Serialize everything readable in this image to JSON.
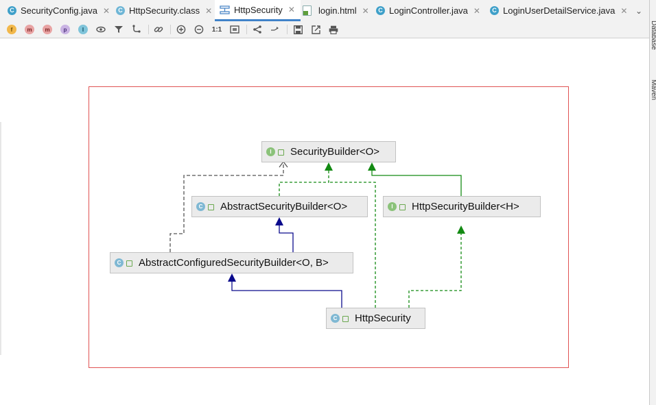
{
  "tabs": [
    {
      "label": "SecurityConfig.java",
      "icon": "class-file-icon",
      "close": "✕",
      "active": false
    },
    {
      "label": "HttpSecurity.class",
      "icon": "compiled-class-icon",
      "close": "✕",
      "active": false
    },
    {
      "label": "HttpSecurity",
      "icon": "diagram-icon",
      "close": "✕",
      "active": true
    },
    {
      "label": "login.html",
      "icon": "html-file-icon",
      "close": "✕",
      "active": false
    },
    {
      "label": "LoginController.java",
      "icon": "class-file-icon",
      "close": "✕",
      "active": false
    },
    {
      "label": "LoginUserDetailService.java",
      "icon": "class-file-icon",
      "close": "✕",
      "active": false
    }
  ],
  "tab_overflow": "⌄",
  "toolbar": {
    "fields": "f",
    "constructors": "m",
    "methods": "m",
    "properties": "p",
    "inner": "I",
    "actual_size": "1:1"
  },
  "side_panels": [
    "Database",
    "Maven"
  ],
  "diagram": {
    "security_builder": "SecurityBuilder<O>",
    "abstract_security_builder": "AbstractSecurityBuilder<O>",
    "http_security_builder": "HttpSecurityBuilder<H>",
    "abstract_configured_security_builder": "AbstractConfiguredSecurityBuilder<O, B>",
    "http_security": "HttpSecurity",
    "interface_letter": "I",
    "class_letter": "C"
  },
  "colors": {
    "extends_edge": "#0a0a8c",
    "implements_edge": "#138a13",
    "dependency_edge": "#555555",
    "frame": "#e05252",
    "active_tab_underline": "#4083c9"
  }
}
